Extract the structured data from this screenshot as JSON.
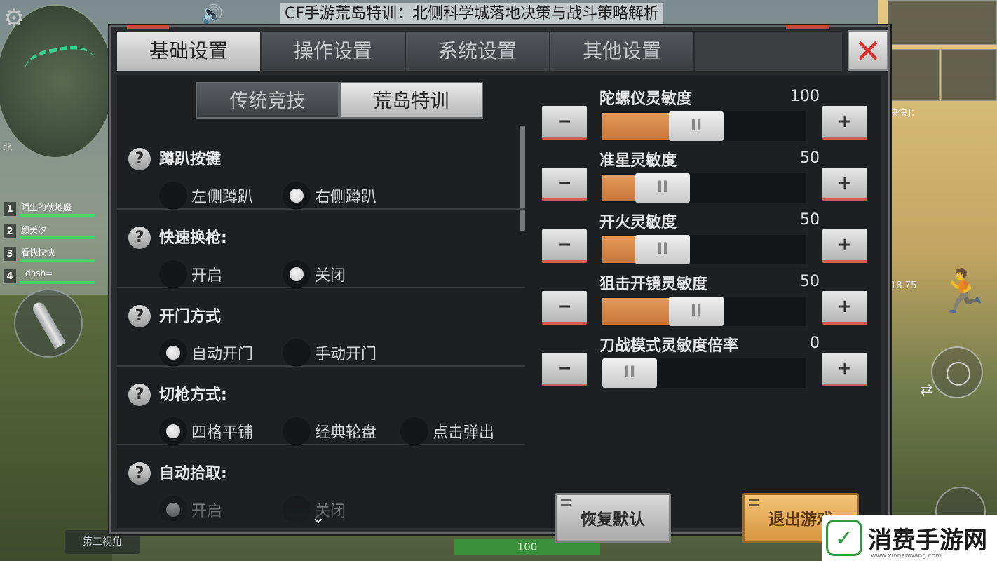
{
  "page_title": "CF手游荒岛特训：北侧科学城落地决策与战斗策略解析",
  "game_hud": {
    "compass": "北",
    "teammates": [
      {
        "num": "1",
        "name": "陌生的伏地魔"
      },
      {
        "num": "2",
        "name": "颜美汐"
      },
      {
        "num": "3",
        "name": "看快快快"
      },
      {
        "num": "4",
        "name": "_dhsh="
      }
    ],
    "view_button": "第三视角",
    "hp_value": "100",
    "chat_label": "快快]：",
    "teammate_tag": "18.75"
  },
  "settings": {
    "tabs": [
      "基础设置",
      "操作设置",
      "系统设置",
      "其他设置"
    ],
    "active_tab": 0,
    "close_icon": "close-icon",
    "mode_tabs": [
      "传统竞技",
      "荒岛特训"
    ],
    "active_mode": 1,
    "sections": [
      {
        "title": "蹲趴按键",
        "options": [
          "左侧蹲趴",
          "右侧蹲趴"
        ],
        "selected": 1
      },
      {
        "title": "快速换枪:",
        "options": [
          "开启",
          "关闭"
        ],
        "selected": 1
      },
      {
        "title": "开门方式",
        "options": [
          "自动开门",
          "手动开门"
        ],
        "selected": 0
      },
      {
        "title": "切枪方式:",
        "options": [
          "四格平铺",
          "经典轮盘",
          "点击弹出"
        ],
        "selected": 0
      },
      {
        "title": "自动拾取:",
        "options": [
          "开启",
          "关闭"
        ],
        "selected": 0
      }
    ],
    "sliders": [
      {
        "label": "陀螺仪灵敏度",
        "value": "100",
        "fill": 0.45
      },
      {
        "label": "准星灵敏度",
        "value": "50",
        "fill": 0.22
      },
      {
        "label": "开火灵敏度",
        "value": "50",
        "fill": 0.22
      },
      {
        "label": "狙击开镜灵敏度",
        "value": "50",
        "fill": 0.45
      },
      {
        "label": "刀战模式灵敏度倍率",
        "value": "0",
        "fill": 0.0
      }
    ],
    "minus_label": "−",
    "plus_label": "+",
    "thumb_label": "II",
    "restore_button": "恢复默认",
    "exit_button": "退出游戏"
  },
  "watermark": {
    "text": "消费手游网",
    "url": "www.xinnanwang.com"
  },
  "colors": {
    "accent_orange": "#d98a47",
    "close_red": "#d8322a",
    "panel_bg": "#2a2b2d",
    "brand_green": "#2b9a3a"
  }
}
